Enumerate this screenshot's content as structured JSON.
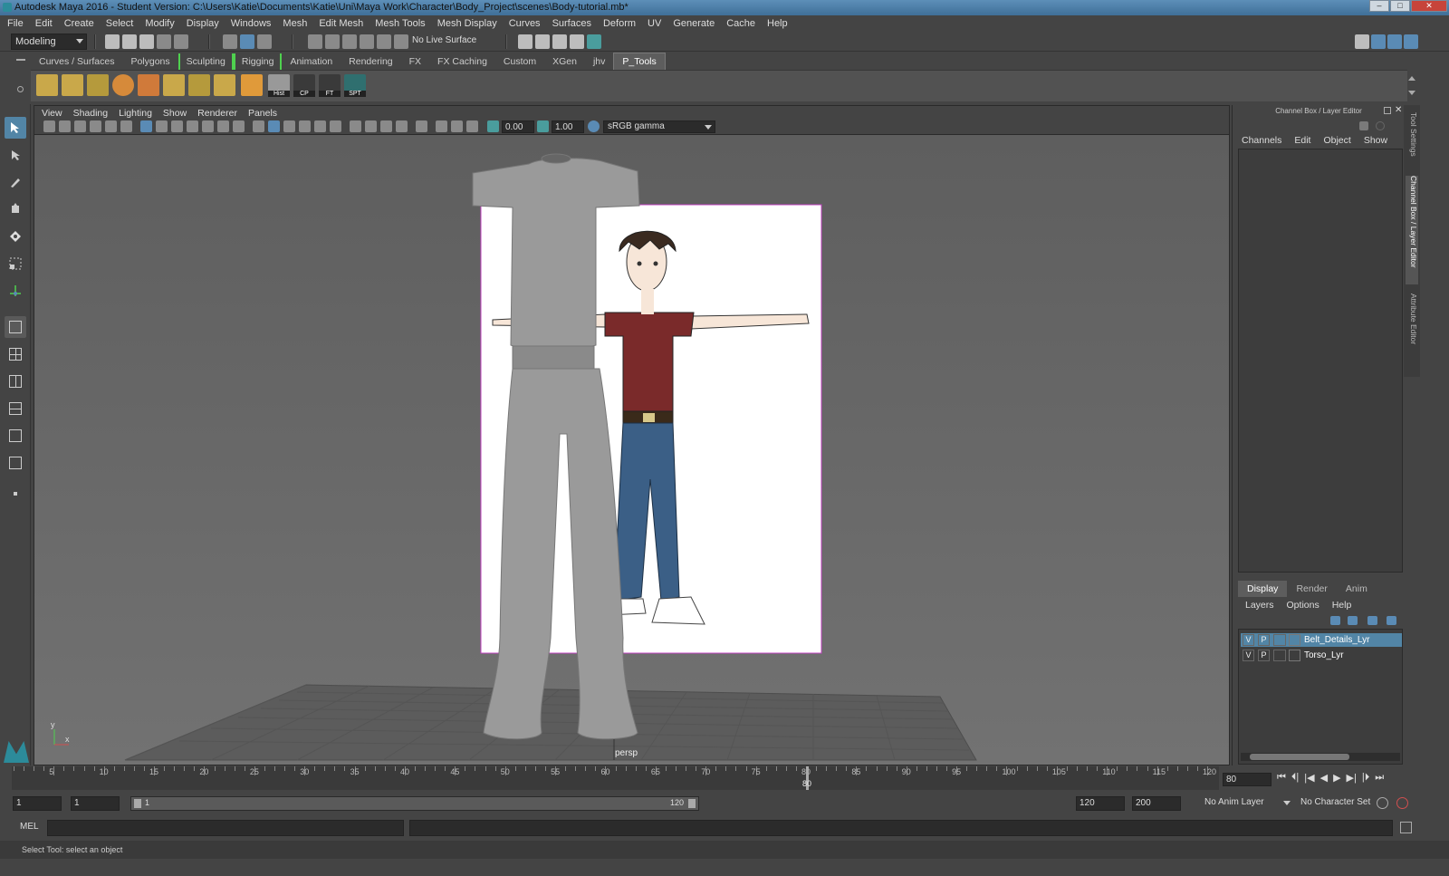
{
  "window": {
    "title": "Autodesk Maya 2016 - Student Version: C:\\Users\\Katie\\Documents\\Katie\\Uni\\Maya Work\\Character\\Body_Project\\scenes\\Body-tutorial.mb*"
  },
  "menubar": [
    "File",
    "Edit",
    "Create",
    "Select",
    "Modify",
    "Display",
    "Windows",
    "Mesh",
    "Edit Mesh",
    "Mesh Tools",
    "Mesh Display",
    "Curves",
    "Surfaces",
    "Deform",
    "UV",
    "Generate",
    "Cache",
    "Help"
  ],
  "statusline": {
    "mode": "Modeling",
    "live_surface": "No Live Surface"
  },
  "shelf": {
    "tabs": [
      "Curves / Surfaces",
      "Polygons",
      "Sculpting",
      "Rigging",
      "Animation",
      "Rendering",
      "FX",
      "FX Caching",
      "Custom",
      "XGen",
      "jhv",
      "P_Tools"
    ],
    "active_tab": "P_Tools",
    "icon_labels": {
      "hist": "Hist",
      "cp": "CP",
      "ft": "FT",
      "spt": "SPT"
    }
  },
  "viewport": {
    "menu": [
      "View",
      "Shading",
      "Lighting",
      "Show",
      "Renderer",
      "Panels"
    ],
    "exposure": "0.00",
    "gamma": "1.00",
    "color_space": "sRGB gamma",
    "camera_label": "persp",
    "axis_x": "x",
    "axis_y": "y"
  },
  "channel_box": {
    "title": "Channel Box / Layer Editor",
    "menu": [
      "Channels",
      "Edit",
      "Object",
      "Show"
    ]
  },
  "layer_editor": {
    "tabs": [
      "Display",
      "Render",
      "Anim"
    ],
    "active_tab": "Display",
    "menu": [
      "Layers",
      "Options",
      "Help"
    ],
    "layers": [
      {
        "v": "V",
        "p": "P",
        "name": "Belt_Details_Lyr",
        "selected": true
      },
      {
        "v": "V",
        "p": "P",
        "name": "Torso_Lyr",
        "selected": false
      }
    ]
  },
  "side_tabs": [
    "Tool Settings",
    "Channel Box / Layer Editor",
    "Attribute Editor"
  ],
  "timeline": {
    "ticks": [
      "5",
      "10",
      "15",
      "20",
      "25",
      "30",
      "35",
      "40",
      "45",
      "50",
      "55",
      "60",
      "65",
      "70",
      "75",
      "80",
      "85",
      "90",
      "95",
      "100",
      "105",
      "110",
      "115",
      "120"
    ],
    "current_frame": "80",
    "current_frame_field": "80"
  },
  "range": {
    "start": "1",
    "playback_start": "1",
    "slider_start": "1",
    "slider_end": "120",
    "playback_end": "120",
    "end": "200",
    "anim_layer": "No Anim Layer",
    "character_set": "No Character Set"
  },
  "command_line": {
    "label": "MEL"
  },
  "help_line": {
    "text": "Select Tool: select an object"
  },
  "colors": {
    "accent": "#5285a6",
    "bg": "#444444",
    "viewport": "#666666",
    "shirt": "#7a2a2a",
    "jeans": "#3b5f86"
  }
}
